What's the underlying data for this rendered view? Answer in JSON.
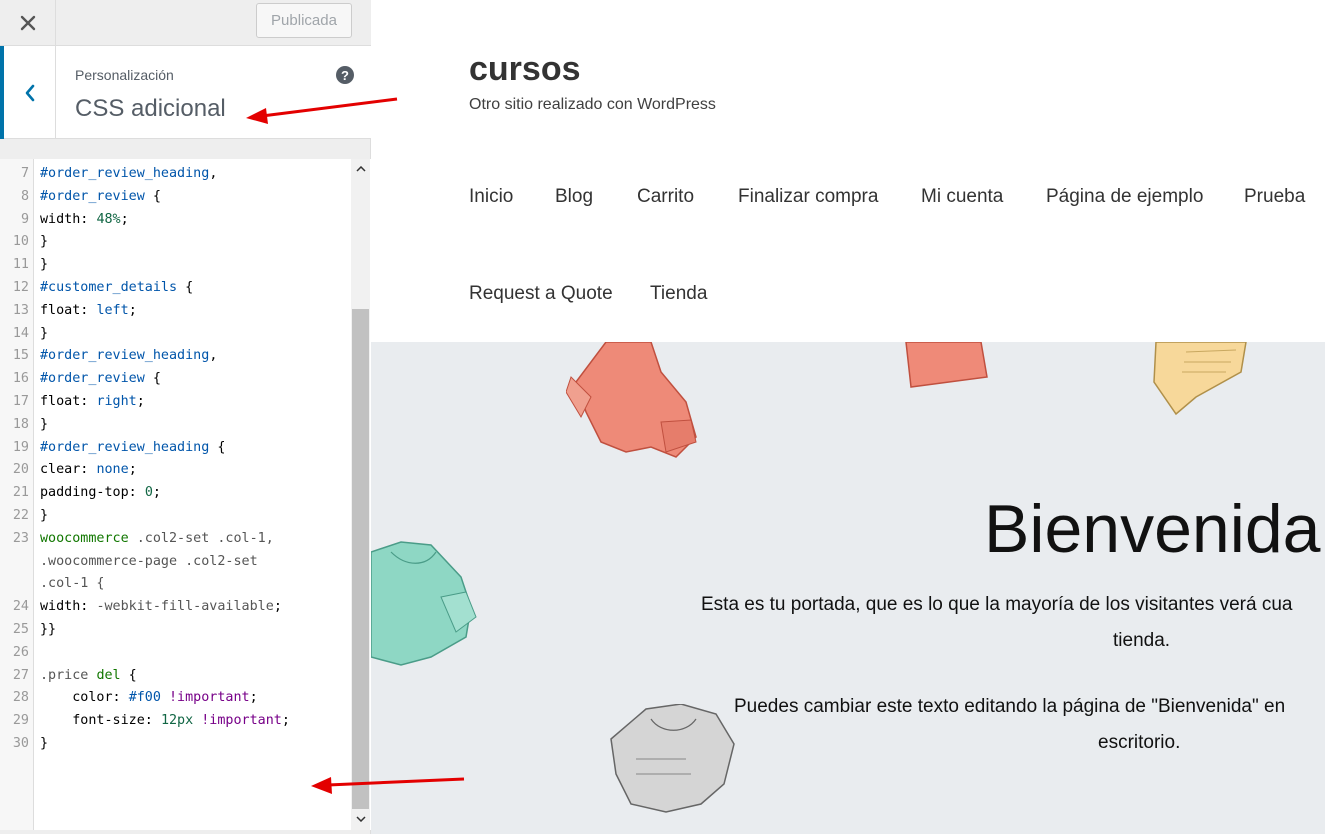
{
  "topbar": {
    "close_icon": "close-icon",
    "publish_label": "Publicada"
  },
  "section": {
    "breadcrumb": "Personalización",
    "title": "CSS adicional",
    "help_icon_text": "?"
  },
  "editor": {
    "lines": [
      {
        "n": "7",
        "t": [
          [
            "#order_review_heading",
            "id"
          ],
          [
            ",",
            "plain"
          ]
        ]
      },
      {
        "n": "8",
        "t": [
          [
            "#order_review",
            "id"
          ],
          [
            " {",
            "plain"
          ]
        ]
      },
      {
        "n": "9",
        "t": [
          [
            "width: ",
            "plain"
          ],
          [
            "48%",
            "num"
          ],
          [
            ";",
            "plain"
          ]
        ]
      },
      {
        "n": "10",
        "t": [
          [
            "}",
            "plain"
          ]
        ]
      },
      {
        "n": "11",
        "t": [
          [
            "}",
            "plain"
          ]
        ]
      },
      {
        "n": "12",
        "t": [
          [
            "#customer_details",
            "id"
          ],
          [
            " {",
            "plain"
          ]
        ]
      },
      {
        "n": "13",
        "t": [
          [
            "float: ",
            "plain"
          ],
          [
            "left",
            "id"
          ],
          [
            ";",
            "plain"
          ]
        ]
      },
      {
        "n": "14",
        "t": [
          [
            "}",
            "plain"
          ]
        ]
      },
      {
        "n": "15",
        "t": [
          [
            "#order_review_heading",
            "id"
          ],
          [
            ",",
            "plain"
          ]
        ]
      },
      {
        "n": "16",
        "t": [
          [
            "#order_review",
            "id"
          ],
          [
            " {",
            "plain"
          ]
        ]
      },
      {
        "n": "17",
        "t": [
          [
            "float: ",
            "plain"
          ],
          [
            "right",
            "id"
          ],
          [
            ";",
            "plain"
          ]
        ]
      },
      {
        "n": "18",
        "t": [
          [
            "}",
            "plain"
          ]
        ]
      },
      {
        "n": "19",
        "t": [
          [
            "#order_review_heading",
            "id"
          ],
          [
            " {",
            "plain"
          ]
        ]
      },
      {
        "n": "20",
        "t": [
          [
            "clear: ",
            "plain"
          ],
          [
            "none",
            "id"
          ],
          [
            ";",
            "plain"
          ]
        ]
      },
      {
        "n": "21",
        "t": [
          [
            "padding-top: ",
            "plain"
          ],
          [
            "0",
            "num"
          ],
          [
            ";",
            "plain"
          ]
        ]
      },
      {
        "n": "22",
        "t": [
          [
            "}",
            "plain"
          ]
        ]
      },
      {
        "n": "23",
        "t": [
          [
            "woocommerce",
            "tag"
          ],
          [
            " .col2-set .col-1,",
            "cls"
          ]
        ]
      },
      {
        "n": "",
        "t": [
          [
            ".woocommerce-page .col2-set",
            "cls"
          ]
        ]
      },
      {
        "n": "",
        "t": [
          [
            ".col-1 {",
            "cls"
          ]
        ]
      },
      {
        "n": "24",
        "t": [
          [
            "width: ",
            "plain"
          ],
          [
            "-webkit-fill-available",
            "cls"
          ],
          [
            ";",
            "plain"
          ]
        ]
      },
      {
        "n": "25",
        "t": [
          [
            "}}",
            "plain"
          ]
        ]
      },
      {
        "n": "26",
        "t": [
          [
            "",
            "plain"
          ]
        ]
      },
      {
        "n": "27",
        "t": [
          [
            ".price ",
            "cls"
          ],
          [
            "del",
            "tag"
          ],
          [
            " {",
            "plain"
          ]
        ]
      },
      {
        "n": "28",
        "t": [
          [
            "    color: ",
            "plain"
          ],
          [
            "#f00",
            "id"
          ],
          [
            " ",
            "plain"
          ],
          [
            "!important",
            "kw"
          ],
          [
            ";",
            "plain"
          ]
        ]
      },
      {
        "n": "29",
        "t": [
          [
            "    font-size: ",
            "plain"
          ],
          [
            "12px",
            "num"
          ],
          [
            " ",
            "plain"
          ],
          [
            "!important",
            "kw"
          ],
          [
            ";",
            "plain"
          ]
        ]
      },
      {
        "n": "30",
        "t": [
          [
            "}",
            "plain"
          ]
        ]
      }
    ]
  },
  "preview": {
    "site_title": "cursos",
    "tagline": "Otro sitio realizado con WordPress",
    "nav": [
      "Inicio",
      "Blog",
      "Carrito",
      "Finalizar compra",
      "Mi cuenta",
      "Página de ejemplo",
      "Prueba",
      "Request a Quote",
      "Tienda"
    ],
    "hero_title": "Bienvenida",
    "hero_p1": "Esta es tu portada, que es lo que la mayoría de los visitantes verá cua",
    "hero_p1b": "tienda.",
    "hero_p2": "Puedes cambiar este texto editando la página de \"Bienvenida\" en",
    "hero_p2b": "escritorio."
  },
  "colors": {
    "accent": "#0073aa",
    "annotation_arrow": "#e30000",
    "hero_bg": "#e9ecef"
  }
}
